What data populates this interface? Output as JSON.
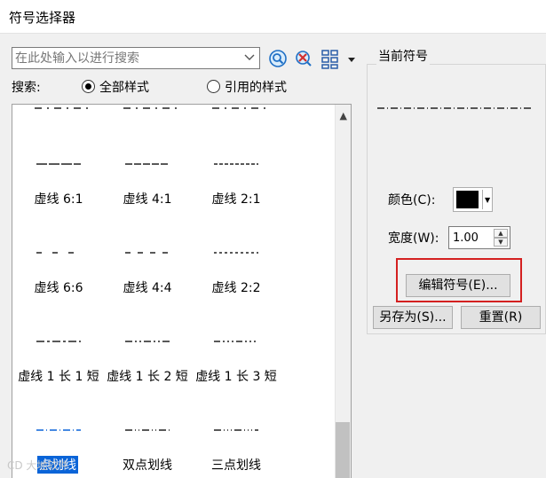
{
  "window": {
    "title": "符号选择器"
  },
  "search": {
    "placeholder": "在此处输入以进行搜索",
    "scope_label": "搜索:",
    "options": [
      {
        "label": "全部样式",
        "checked": true
      },
      {
        "label": "引用的样式",
        "checked": false
      }
    ]
  },
  "toolbar": {
    "icons": [
      "search-icon",
      "clear-search-icon",
      "grid-view-icon",
      "dropdown-arrow-icon"
    ]
  },
  "symbols": [
    {
      "label": "虚线 6:1",
      "pattern": [
        12,
        2
      ],
      "selected": false
    },
    {
      "label": "虚线 4:1",
      "pattern": [
        8,
        2
      ],
      "selected": false
    },
    {
      "label": "虚线 2:1",
      "pattern": [
        4,
        2
      ],
      "selected": false
    },
    {
      "label": "虚线 6:6",
      "pattern": [
        6,
        12
      ],
      "selected": false
    },
    {
      "label": "虚线 4:4",
      "pattern": [
        6,
        8
      ],
      "selected": false
    },
    {
      "label": "虚线 2:2",
      "pattern": [
        3,
        3
      ],
      "selected": false
    },
    {
      "label": "虚线 1 长 1 短",
      "pattern": [
        9,
        3,
        3,
        3
      ],
      "selected": false
    },
    {
      "label": "虚线 1 长 2 短",
      "pattern": [
        8,
        3,
        2,
        3,
        2,
        3
      ],
      "selected": false
    },
    {
      "label": "虚线 1 长 3 短",
      "pattern": [
        7,
        3,
        2,
        3,
        2,
        3,
        2,
        3
      ],
      "selected": false
    },
    {
      "label": "点划线",
      "pattern": [
        8,
        3,
        1,
        3
      ],
      "selected": true
    },
    {
      "label": "双点划线",
      "pattern": [
        8,
        3,
        1,
        3,
        1,
        3
      ],
      "selected": false
    },
    {
      "label": "三点划线",
      "pattern": [
        8,
        3,
        1,
        3,
        1,
        3,
        1,
        3
      ],
      "selected": false
    }
  ],
  "current": {
    "title": "当前符号",
    "color_label": "颜色(C):",
    "color_value": "#000000",
    "width_label": "宽度(W):",
    "width_value": "1.00",
    "edit_button": "编辑符号(E)...",
    "save_as_button": "另存为(S)...",
    "reset_button": "重置(R)"
  },
  "colors": {
    "selection": "#0a64d8",
    "highlight_box": "#d42020"
  },
  "watermark": "CD 大地软件"
}
